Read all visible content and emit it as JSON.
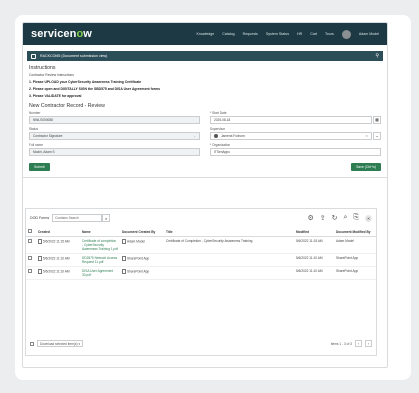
{
  "topnav": {
    "brand_a": "servicen",
    "brand_o": "o",
    "brand_b": "w",
    "links": [
      "Knowledge",
      "Catalog",
      "Requests",
      "System Status",
      "HR",
      "Cart",
      "Tours"
    ],
    "user": "Adam Model"
  },
  "formbar": {
    "title": "RACKCOM5 (Document submission view)"
  },
  "instructions": {
    "heading": "Instructions",
    "subheading": "Contractor Review Instructions",
    "steps": [
      "1. Please UPLOAD your CyberSecurity Awareness Training Certificate",
      "2. Please open and DIGITALLY SIGN the SBD575 and DISA User Agreement forms",
      "3. Please VALIDATE for approval"
    ]
  },
  "record": {
    "heading": "New Contractor Record - Review",
    "number_label": "Number",
    "number_value": "NWLS000088",
    "start_label": "* Start Date",
    "start_value": "2025-08-18",
    "status_label": "Status",
    "status_value": "Contractor Signature",
    "supervisor_label": "Supervisor",
    "supervisor_value": "Jameria Foxhorn",
    "fullname_label": "Full name",
    "fullname_value": "Model, Adam S",
    "org_label": "* Organization",
    "org_value": "ITSenAppo"
  },
  "actions": {
    "submit": "Submit",
    "save": "Save (Ctrl+s)"
  },
  "docs": {
    "title": "DOD Forms",
    "search_placeholder": "Contains Search",
    "columns": [
      "Created",
      "Name",
      "Document Created By",
      "Title",
      "Modified",
      "Document Modified By"
    ],
    "rows": [
      {
        "created": "5/6/2022 11:15 AM",
        "name": "Certificate of completion - CyberSecurity Awareness Training 1.pdf",
        "created_by": "Adam Model",
        "title": "Certificate of Completion - CyberSecurity Awareness Training",
        "modified": "5/6/2022 11:15 AM",
        "modified_by": "Adam Model"
      },
      {
        "created": "5/6/2022 11:10 AM",
        "name": "DD2875 Network Access Request 11.pdf",
        "created_by": "SharePoint App",
        "title": "",
        "modified": "5/6/2022 11:10 AM",
        "modified_by": "SharePoint App"
      },
      {
        "created": "5/6/2022 11:10 AM",
        "name": "DISA User Agreement 30.pdf",
        "created_by": "SharePoint App",
        "title": "",
        "modified": "5/6/2022 11:10 AM",
        "modified_by": "SharePoint App"
      }
    ],
    "footer_select": "Download selected item(s)",
    "page_info": "Items 1 - 3 of 3"
  }
}
